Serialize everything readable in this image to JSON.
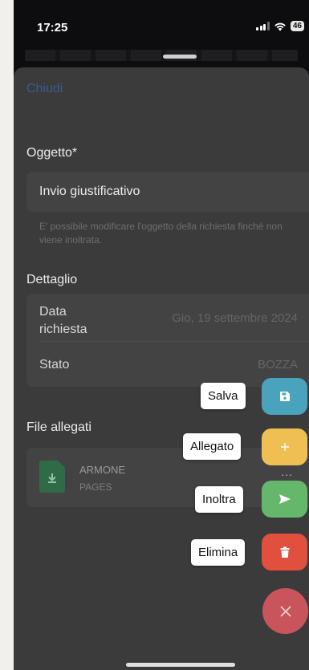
{
  "status_bar": {
    "time": "17:25",
    "battery": "46"
  },
  "sheet": {
    "close_label": "Chiudi",
    "subject": {
      "title": "Oggetto*",
      "value": "Invio giustificativo",
      "hint": "E' possibile modificare l'oggetto della richiesta finché non viene inoltrata."
    },
    "detail": {
      "title": "Dettaglio",
      "date_label": "Data richiesta",
      "date_value": "Gio, 19 settembre 2024",
      "status_label": "Stato",
      "status_value": "BOZZA"
    },
    "attachments": {
      "title": "File allegati",
      "file_name": "ARMONE",
      "file_type": "PAGES",
      "more": "..."
    }
  },
  "fab_menu": {
    "save": {
      "label": "Salva",
      "color": "#4aa3bd",
      "icon": "floppy-disk-icon"
    },
    "attach": {
      "label": "Allegato",
      "color": "#f0bf54",
      "icon": "plus-icon"
    },
    "forward": {
      "label": "Inoltra",
      "color": "#64b76b",
      "icon": "send-icon"
    },
    "delete": {
      "label": "Elimina",
      "color": "#e14f3e",
      "icon": "trash-icon"
    },
    "close": {
      "color": "#c9545c",
      "icon": "close-icon"
    }
  }
}
